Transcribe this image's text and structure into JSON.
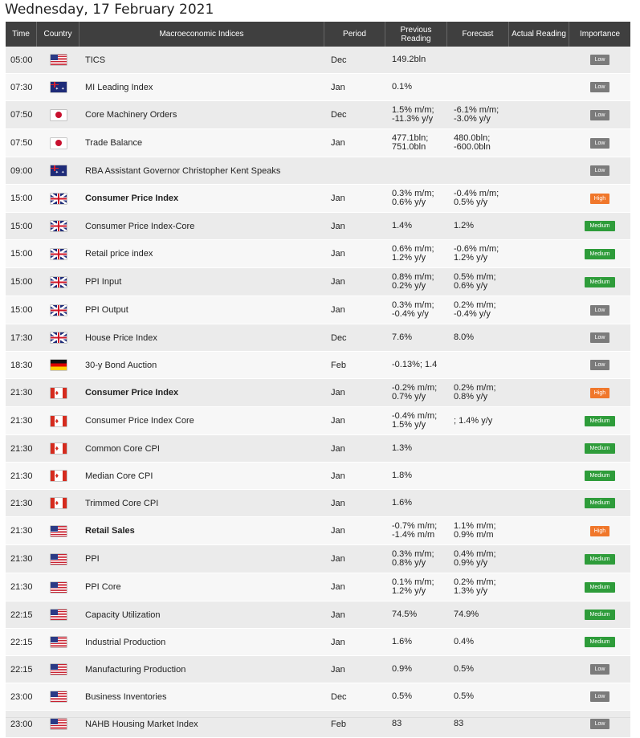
{
  "title": "Wednesday, 17 February 2021",
  "header": {
    "time": "Time",
    "country": "Country",
    "indices": "Macroeconomic Indices",
    "period": "Period",
    "previous": "Previous\nReading",
    "forecast": "Forecast",
    "actual": "Actual Reading",
    "importance": "Importance"
  },
  "colors": {
    "header_bg": "#3f3f3f",
    "low": "#7b7b7b",
    "medium": "#2e9c3a",
    "high": "#f0772b"
  },
  "rows": [
    {
      "time": "05:00",
      "country": "us",
      "event": "TICS",
      "bold": false,
      "period": "Dec",
      "previous": "149.2bln",
      "forecast": "",
      "actual": "",
      "importance": "Low",
      "level": "low"
    },
    {
      "time": "07:30",
      "country": "au",
      "event": "MI Leading Index",
      "bold": false,
      "period": "Jan",
      "previous": "0.1%",
      "forecast": "",
      "actual": "",
      "importance": "Low",
      "level": "low"
    },
    {
      "time": "07:50",
      "country": "jp",
      "event": "Core Machinery Orders",
      "bold": false,
      "period": "Dec",
      "previous": "1.5% m/m;\n-11.3% y/y",
      "forecast": "-6.1% m/m;\n-3.0% y/y",
      "actual": "",
      "importance": "Low",
      "level": "low"
    },
    {
      "time": "07:50",
      "country": "jp",
      "event": "Trade Balance",
      "bold": false,
      "period": "Jan",
      "previous": "477.1bln;\n751.0bln",
      "forecast": "480.0bln;\n-600.0bln",
      "actual": "",
      "importance": "Low",
      "level": "low"
    },
    {
      "time": "09:00",
      "country": "au",
      "event": "RBA Assistant Governor Christopher Kent Speaks",
      "bold": false,
      "period": "",
      "previous": "",
      "forecast": "",
      "actual": "",
      "importance": "Low",
      "level": "low"
    },
    {
      "time": "15:00",
      "country": "uk",
      "event": "Consumer Price Index",
      "bold": true,
      "period": "Jan",
      "previous": "0.3% m/m;\n0.6% y/y",
      "forecast": "-0.4% m/m;\n0.5% y/y",
      "actual": "",
      "importance": "High",
      "level": "high"
    },
    {
      "time": "15:00",
      "country": "uk",
      "event": "Consumer Price Index-Core",
      "bold": false,
      "period": "Jan",
      "previous": "1.4%",
      "forecast": "1.2%",
      "actual": "",
      "importance": "Medium",
      "level": "medium"
    },
    {
      "time": "15:00",
      "country": "uk",
      "event": "Retail price index",
      "bold": false,
      "period": "Jan",
      "previous": "0.6% m/m;\n1.2% y/y",
      "forecast": "-0.6% m/m;\n1.2% y/y",
      "actual": "",
      "importance": "Medium",
      "level": "medium"
    },
    {
      "time": "15:00",
      "country": "uk",
      "event": "PPI Input",
      "bold": false,
      "period": "Jan",
      "previous": "0.8% m/m;\n0.2% y/y",
      "forecast": "0.5% m/m;\n0.6% y/y",
      "actual": "",
      "importance": "Medium",
      "level": "medium"
    },
    {
      "time": "15:00",
      "country": "uk",
      "event": "PPI Output",
      "bold": false,
      "period": "Jan",
      "previous": "0.3% m/m;\n-0.4% y/y",
      "forecast": "0.2% m/m;\n-0.4% y/y",
      "actual": "",
      "importance": "Low",
      "level": "low"
    },
    {
      "time": "17:30",
      "country": "uk",
      "event": "House Price Index",
      "bold": false,
      "period": "Dec",
      "previous": "7.6%",
      "forecast": "8.0%",
      "actual": "",
      "importance": "Low",
      "level": "low"
    },
    {
      "time": "18:30",
      "country": "de",
      "event": "30-y Bond Auction",
      "bold": false,
      "period": "Feb",
      "previous": "-0.13%; 1.4",
      "forecast": "",
      "actual": "",
      "importance": "Low",
      "level": "low"
    },
    {
      "time": "21:30",
      "country": "ca",
      "event": "Consumer Price Index",
      "bold": true,
      "period": "Jan",
      "previous": "-0.2% m/m;\n0.7% y/y",
      "forecast": "0.2% m/m;\n0.8% y/y",
      "actual": "",
      "importance": "High",
      "level": "high"
    },
    {
      "time": "21:30",
      "country": "ca",
      "event": "Consumer Price Index Core",
      "bold": false,
      "period": "Jan",
      "previous": "-0.4% m/m;\n1.5% y/y",
      "forecast": "; 1.4% y/y",
      "actual": "",
      "importance": "Medium",
      "level": "medium"
    },
    {
      "time": "21:30",
      "country": "ca",
      "event": "Common Core CPI",
      "bold": false,
      "period": "Jan",
      "previous": "1.3%",
      "forecast": "",
      "actual": "",
      "importance": "Medium",
      "level": "medium"
    },
    {
      "time": "21:30",
      "country": "ca",
      "event": "Median Core CPI",
      "bold": false,
      "period": "Jan",
      "previous": "1.8%",
      "forecast": "",
      "actual": "",
      "importance": "Medium",
      "level": "medium"
    },
    {
      "time": "21:30",
      "country": "ca",
      "event": "Trimmed Core CPI",
      "bold": false,
      "period": "Jan",
      "previous": "1.6%",
      "forecast": "",
      "actual": "",
      "importance": "Medium",
      "level": "medium"
    },
    {
      "time": "21:30",
      "country": "us",
      "event": "Retail Sales",
      "bold": true,
      "period": "Jan",
      "previous": "-0.7% m/m;\n-1.4% m/m",
      "forecast": "1.1% m/m;\n0.9% m/m",
      "actual": "",
      "importance": "High",
      "level": "high"
    },
    {
      "time": "21:30",
      "country": "us",
      "event": "PPI",
      "bold": false,
      "period": "Jan",
      "previous": "0.3% m/m;\n0.8% y/y",
      "forecast": "0.4% m/m;\n0.9% y/y",
      "actual": "",
      "importance": "Medium",
      "level": "medium"
    },
    {
      "time": "21:30",
      "country": "us",
      "event": "PPI Core",
      "bold": false,
      "period": "Jan",
      "previous": "0.1% m/m;\n1.2% y/y",
      "forecast": "0.2% m/m;\n1.3% y/y",
      "actual": "",
      "importance": "Medium",
      "level": "medium"
    },
    {
      "time": "22:15",
      "country": "us",
      "event": "Capacity Utilization",
      "bold": false,
      "period": "Jan",
      "previous": "74.5%",
      "forecast": "74.9%",
      "actual": "",
      "importance": "Medium",
      "level": "medium"
    },
    {
      "time": "22:15",
      "country": "us",
      "event": "Industrial Production",
      "bold": false,
      "period": "Jan",
      "previous": "1.6%",
      "forecast": "0.4%",
      "actual": "",
      "importance": "Medium",
      "level": "medium"
    },
    {
      "time": "22:15",
      "country": "us",
      "event": "Manufacturing Production",
      "bold": false,
      "period": "Jan",
      "previous": "0.9%",
      "forecast": "0.5%",
      "actual": "",
      "importance": "Low",
      "level": "low"
    },
    {
      "time": "23:00",
      "country": "us",
      "event": "Business Inventories",
      "bold": false,
      "period": "Dec",
      "previous": "0.5%",
      "forecast": "0.5%",
      "actual": "",
      "importance": "Low",
      "level": "low"
    },
    {
      "time": "23:00",
      "country": "us",
      "event": "NAHB Housing Market Index",
      "bold": false,
      "period": "Feb",
      "previous": "83",
      "forecast": "83",
      "actual": "",
      "importance": "Low",
      "level": "low"
    }
  ]
}
